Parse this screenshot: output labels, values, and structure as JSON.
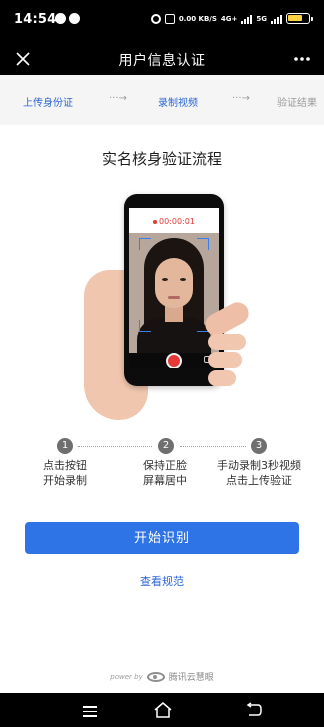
{
  "status_bar": {
    "time": "14:54",
    "data_speed": "0.00 KB/S",
    "network_1": "4G+",
    "network_2": "5G"
  },
  "nav_bar": {
    "title": "用户信息认证",
    "close_icon": "close-icon",
    "more_icon": "more-icon"
  },
  "progress": {
    "steps": [
      "上传身份证",
      "录制视频",
      "验证结果"
    ],
    "separator": "···→",
    "active_color": "#2c66d4",
    "inactive_color": "#9a9a9a"
  },
  "flow_title": "实名核身验证流程",
  "illustration": {
    "timer": "00:00:01"
  },
  "steps": [
    {
      "number": "1",
      "line1": "点击按钮",
      "line2": "开始录制"
    },
    {
      "number": "2",
      "line1": "保持正脸",
      "line2": "屏幕居中"
    },
    {
      "number": "3",
      "line1": "手动录制3秒视频",
      "line2": "点击上传验证"
    }
  ],
  "start_button": {
    "label": "开始识别",
    "color": "#2e74e6"
  },
  "spec_link": "查看规范",
  "powered": {
    "by_text": "power by",
    "brand": "腾讯云慧眼"
  },
  "system_nav": {
    "icons": [
      "menu-icon",
      "home-icon",
      "back-icon"
    ]
  }
}
